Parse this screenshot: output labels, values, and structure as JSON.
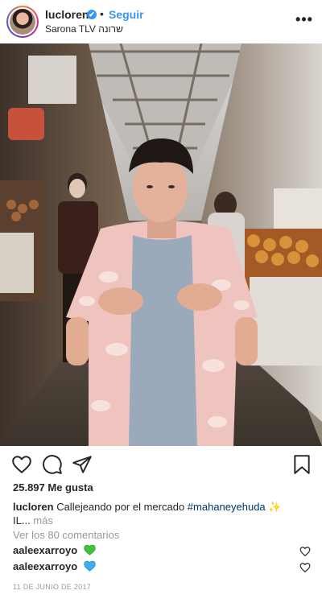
{
  "header": {
    "username": "lucloren",
    "verified_mark": "✔",
    "separator": "•",
    "follow_label": "Seguir",
    "location": "Sarona TLV שרונה",
    "more_label": "•••"
  },
  "actions": {
    "icons": [
      "heart-icon",
      "comment-icon",
      "share-icon",
      "bookmark-icon"
    ]
  },
  "post": {
    "likes": "25.897 Me gusta",
    "caption_user": "lucloren",
    "caption_text": " Callejeando por el mercado ",
    "caption_hashtag": "#mahaneyehuda",
    "caption_emoji": "✨",
    "caption_line2": "IL...",
    "caption_more": " más",
    "view_comments": "Ver los 80 comentarios",
    "date": "11 DE JUNIO DE 2017"
  },
  "comments": [
    {
      "user": "aaleexarroyo",
      "emoji": "green-heart",
      "color": "#3ec43e"
    },
    {
      "user": "aaleexarroyo",
      "emoji": "blue-heart",
      "color": "#3ab0f0"
    }
  ],
  "colors": {
    "accent": "#3897f0",
    "text": "#262626",
    "muted": "#999999",
    "hashtag": "#003569"
  }
}
